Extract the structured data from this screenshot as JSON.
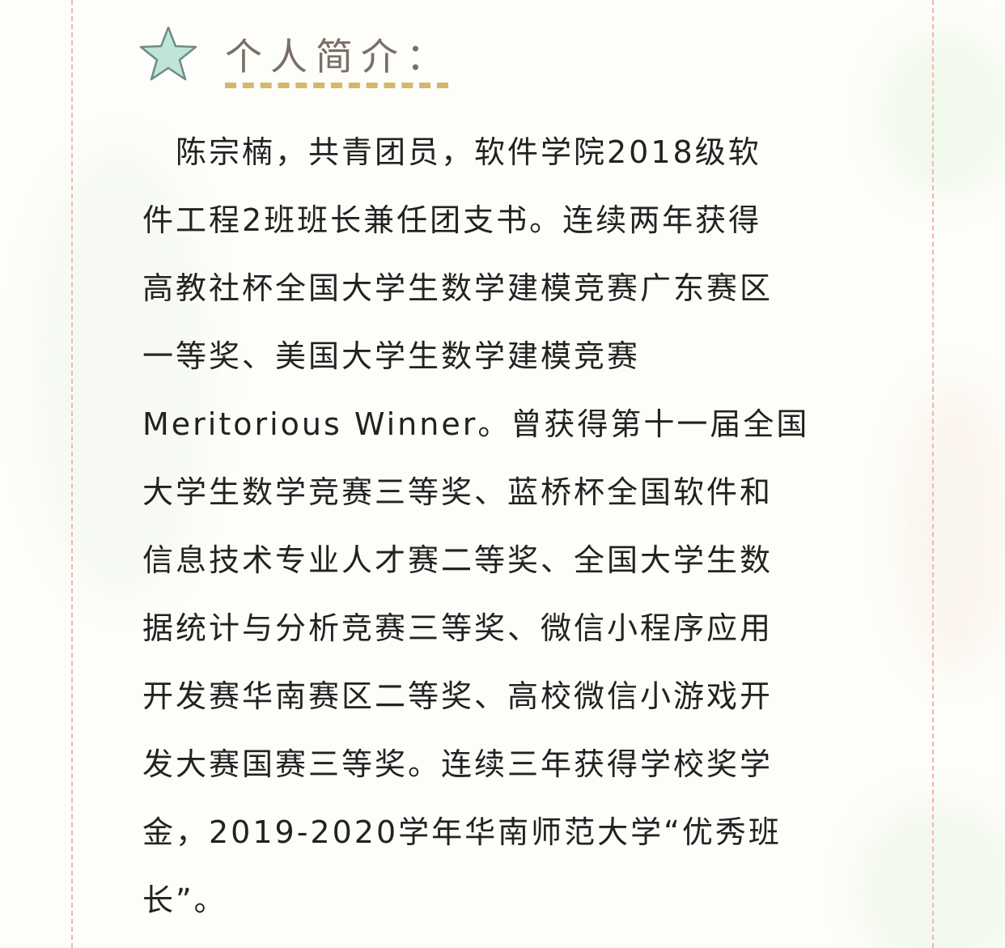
{
  "section": {
    "icon": "star-icon",
    "title": "个人简介："
  },
  "body": {
    "lines": [
      "　陈宗楠，共青团员，软件学院2018级软",
      "件工程2班班长兼任团支书。连续两年获得",
      "高教社杯全国大学生数学建模竞赛广东赛区",
      "一等奖、美国大学生数学建模竞赛",
      "Meritorious Winner。曾获得第十一届全国",
      "大学生数学竞赛三等奖、蓝桥杯全国软件和",
      "信息技术专业人才赛二等奖、全国大学生数",
      "据统计与分析竞赛三等奖、微信小程序应用",
      "开发赛华南赛区二等奖、高校微信小游戏开",
      "发大赛国赛三等奖。连续三年获得学校奖学",
      "金，2019-2020学年华南师范大学“优秀班",
      "长”。"
    ]
  },
  "colors": {
    "star_fill": "#bfe4d8",
    "star_stroke": "#6f8c86",
    "heading": "#7a6f64",
    "underline": "#d2b96a",
    "frame": "#f0b7a8",
    "text": "#222222"
  }
}
